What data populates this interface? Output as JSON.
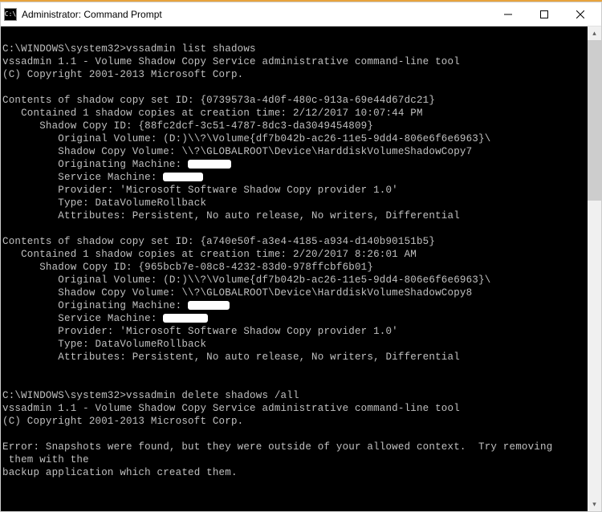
{
  "window": {
    "title": "Administrator: Command Prompt",
    "icon_text": "C:\\"
  },
  "terminal": {
    "prompt1": "C:\\WINDOWS\\system32>",
    "cmd1": "vssadmin list shadows",
    "banner_line1": "vssadmin 1.1 - Volume Shadow Copy Service administrative command-line tool",
    "banner_line2": "(C) Copyright 2001-2013 Microsoft Corp.",
    "set1": {
      "header": "Contents of shadow copy set ID: {0739573a-4d0f-480c-913a-69e44d67dc21}",
      "contained": "   Contained 1 shadow copies at creation time: 2/12/2017 10:07:44 PM",
      "copy_id": "      Shadow Copy ID: {88fc2dcf-3c51-4787-8dc3-da3049454809}",
      "orig_vol": "         Original Volume: (D:)\\\\?\\Volume{df7b042b-ac26-11e5-9dd4-806e6f6e6963}\\",
      "shadow_vol": "         Shadow Copy Volume: \\\\?\\GLOBALROOT\\Device\\HarddiskVolumeShadowCopy7",
      "orig_machine_label": "         Originating Machine: ",
      "svc_machine_label": "         Service Machine: ",
      "provider": "         Provider: 'Microsoft Software Shadow Copy provider 1.0'",
      "type": "         Type: DataVolumeRollback",
      "attrs": "         Attributes: Persistent, No auto release, No writers, Differential"
    },
    "set2": {
      "header": "Contents of shadow copy set ID: {a740e50f-a3e4-4185-a934-d140b90151b5}",
      "contained": "   Contained 1 shadow copies at creation time: 2/20/2017 8:26:01 AM",
      "copy_id": "      Shadow Copy ID: {965bcb7e-08c8-4232-83d0-978ffcbf6b01}",
      "orig_vol": "         Original Volume: (D:)\\\\?\\Volume{df7b042b-ac26-11e5-9dd4-806e6f6e6963}\\",
      "shadow_vol": "         Shadow Copy Volume: \\\\?\\GLOBALROOT\\Device\\HarddiskVolumeShadowCopy8",
      "orig_machine_label": "         Originating Machine: ",
      "svc_machine_label": "         Service Machine: ",
      "provider": "         Provider: 'Microsoft Software Shadow Copy provider 1.0'",
      "type": "         Type: DataVolumeRollback",
      "attrs": "         Attributes: Persistent, No auto release, No writers, Differential"
    },
    "prompt2": "C:\\WINDOWS\\system32>",
    "cmd2": "vssadmin delete shadows /all",
    "banner2_line1": "vssadmin 1.1 - Volume Shadow Copy Service administrative command-line tool",
    "banner2_line2": "(C) Copyright 2001-2013 Microsoft Corp.",
    "error": {
      "l1": "Error: Snapshots were found, but they were outside of your allowed context.  Try removing",
      "l2": " them with the",
      "l3": "backup application which created them."
    }
  }
}
